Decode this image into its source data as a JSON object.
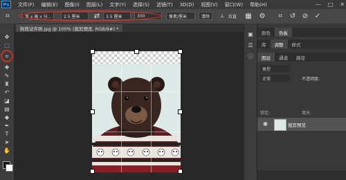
{
  "menu": {
    "logo": "Ps",
    "items": [
      "文件(F)",
      "编辑(E)",
      "图像(I)",
      "图层(L)",
      "文字(Y)",
      "选择(S)",
      "滤镜(T)",
      "3D(D)",
      "视图(V)",
      "窗口(W)",
      "帮助(H)"
    ],
    "window_buttons": [
      "—",
      "□",
      "✕"
    ]
  },
  "options": {
    "ratio_select": "宽 x 高 x 分...",
    "width_value": "2.5 厘米",
    "height_value": "3.5 厘米",
    "resolution_value": "300",
    "unit_select": "像素/厘米",
    "clear_button": "清除",
    "straighten_label": "拉直"
  },
  "document": {
    "tab_label": "狗熊证件照.jpg @ 100% (裁剪预览, RGB/8#) *"
  },
  "panels": {
    "top_tabs": [
      "颜色",
      "色板"
    ],
    "mid_tabs": [
      "库",
      "调整",
      "样式"
    ],
    "layer_tabs": [
      "图层",
      "通道",
      "路径"
    ],
    "kind_filter": "类型",
    "blend_mode": "正常",
    "opacity_label": "不透明度:",
    "lock_label": "锁定:",
    "fill_label": "填充:",
    "layer_name": "裁剪预览"
  },
  "colors": {
    "accent_highlight": "#c8302c",
    "foreground": "#111111",
    "background": "#ffffff"
  }
}
